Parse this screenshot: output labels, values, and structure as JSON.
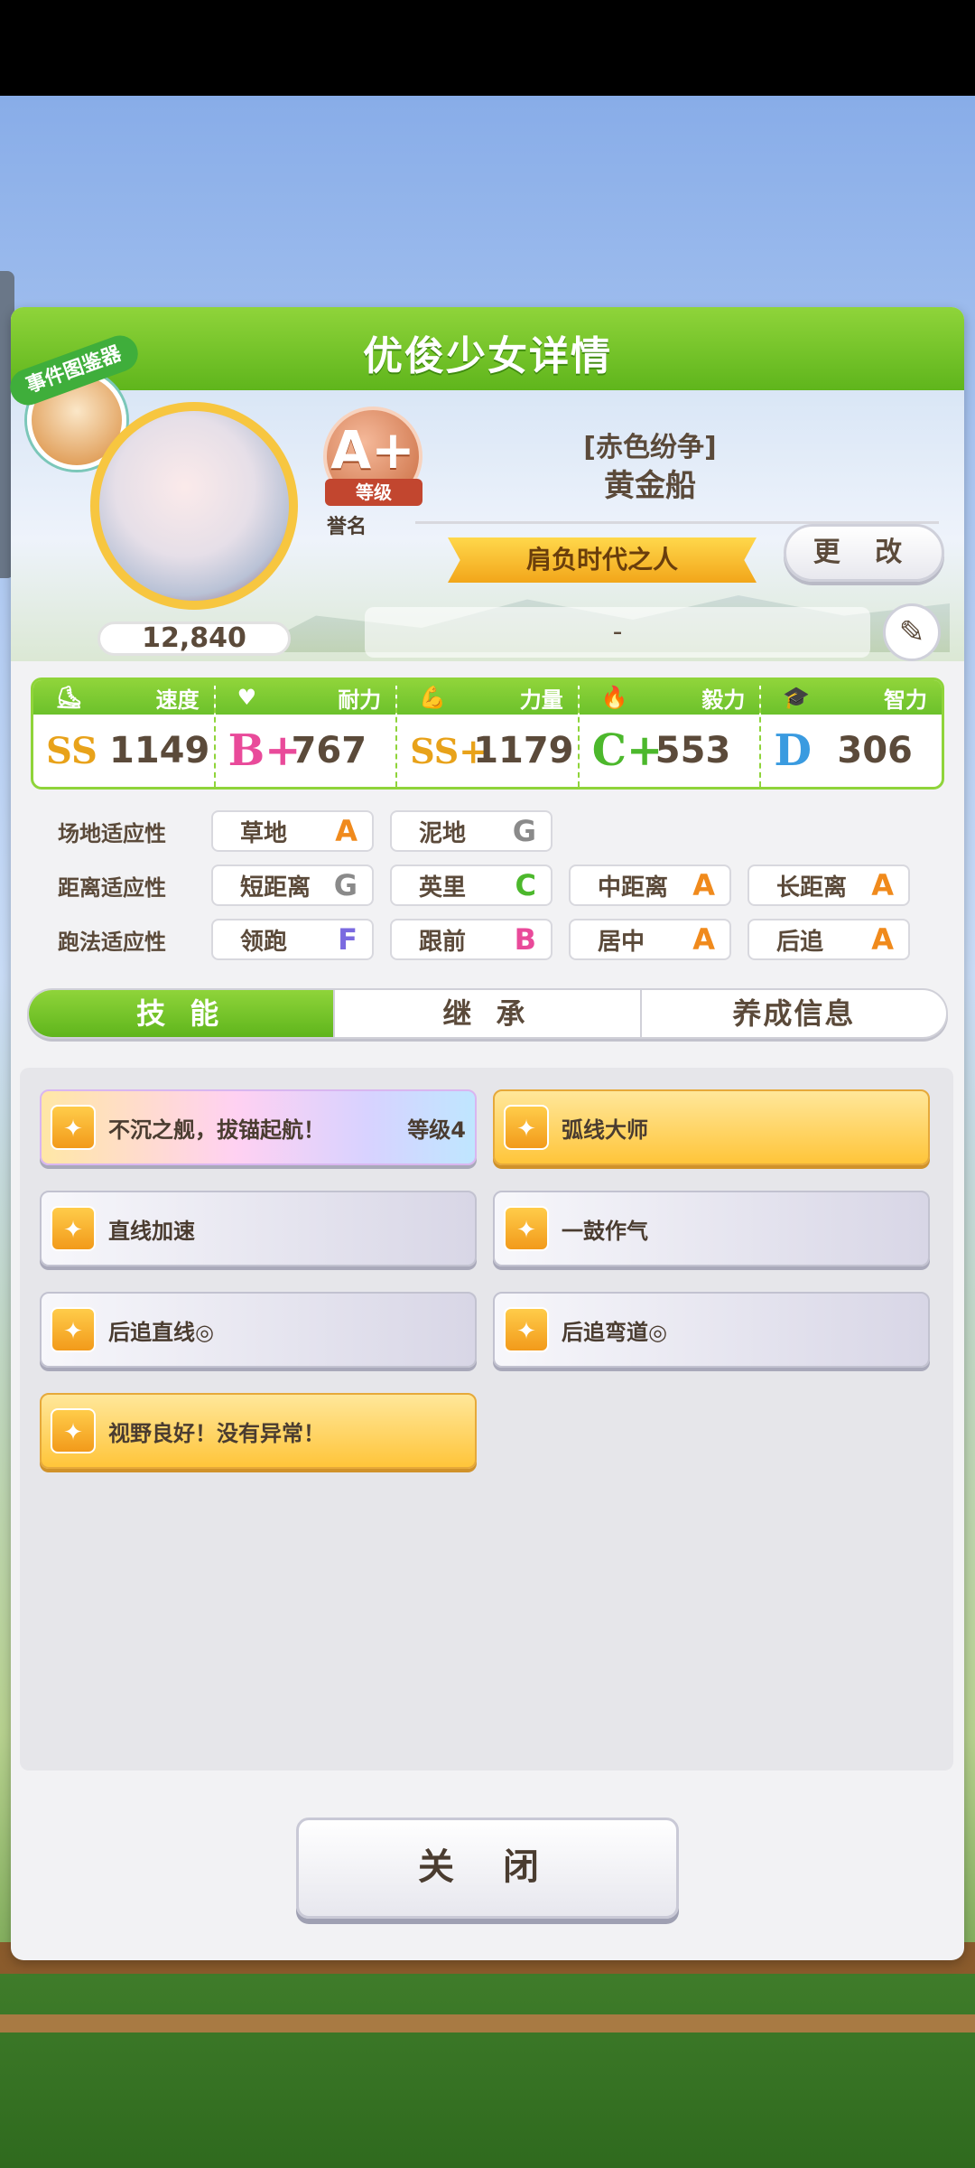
{
  "header": {
    "title": "优俊少女详情"
  },
  "chooser_badge": {
    "label": "事件图鉴器"
  },
  "profile": {
    "fans": "12,840",
    "grade": "A+",
    "grade_ribbon": "等级",
    "honor_label": "誉名",
    "epithet": "[赤色纷争]",
    "name": "黄金船",
    "title": "肩负时代之人",
    "change_label": "更 改",
    "subtitle_value": "-"
  },
  "stats": [
    {
      "label": "速度",
      "icon": "shoe-icon",
      "rank": "SS",
      "value": "1149",
      "color": "#e8a21a"
    },
    {
      "label": "耐力",
      "icon": "heart-icon",
      "rank": "B+",
      "value": "767",
      "color": "#e94a9a"
    },
    {
      "label": "力量",
      "icon": "muscle-icon",
      "rank": "SS+",
      "value": "1179",
      "color": "#e8a21a"
    },
    {
      "label": "毅力",
      "icon": "flame-icon",
      "rank": "C+",
      "value": "553",
      "color": "#4cb82c"
    },
    {
      "label": "智力",
      "icon": "graduation-cap-icon",
      "rank": "D",
      "value": "306",
      "color": "#3a9be0"
    }
  ],
  "aptitudes": {
    "track": {
      "label": "场地适应性",
      "items": [
        {
          "name": "草地",
          "grade": "A"
        },
        {
          "name": "泥地",
          "grade": "G"
        }
      ]
    },
    "distance": {
      "label": "距离适应性",
      "items": [
        {
          "name": "短距离",
          "grade": "G"
        },
        {
          "name": "英里",
          "grade": "C"
        },
        {
          "name": "中距离",
          "grade": "A"
        },
        {
          "name": "长距离",
          "grade": "A"
        }
      ]
    },
    "style": {
      "label": "跑法适应性",
      "items": [
        {
          "name": "领跑",
          "grade": "F"
        },
        {
          "name": "跟前",
          "grade": "B"
        },
        {
          "name": "居中",
          "grade": "A"
        },
        {
          "name": "后追",
          "grade": "A"
        }
      ]
    }
  },
  "grade_colors": {
    "A": "#f08a1c",
    "B": "#e94a9a",
    "C": "#4cb82c",
    "F": "#7a6ae0",
    "G": "#8a8a8a"
  },
  "tabs": [
    {
      "label": "技 能",
      "active": true
    },
    {
      "label": "继 承",
      "active": false
    },
    {
      "label": "养成信息",
      "active": false
    }
  ],
  "skills": [
    {
      "name": "不沉之舰，拔锚起航！",
      "level": "等级4",
      "style": "rainbow"
    },
    {
      "name": "弧线大师",
      "level": "",
      "style": "gold"
    },
    {
      "name": "直线加速",
      "level": "",
      "style": "plain"
    },
    {
      "name": "一鼓作气",
      "level": "",
      "style": "plain"
    },
    {
      "name": "后追直线◎",
      "level": "",
      "style": "plain"
    },
    {
      "name": "后追弯道◎",
      "level": "",
      "style": "plain"
    },
    {
      "name": "视野良好！没有异常！",
      "level": "",
      "style": "gold"
    }
  ],
  "close_label": "关 闭"
}
